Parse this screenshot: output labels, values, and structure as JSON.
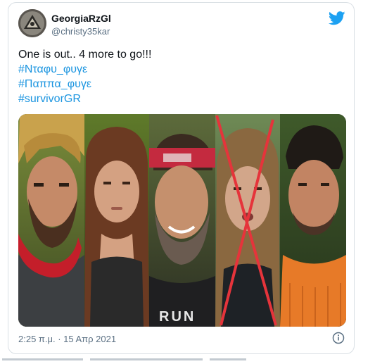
{
  "author": {
    "display_name": "GeorgiaRzGl",
    "handle": "@christy35kar"
  },
  "tweet": {
    "text": "One is out.. 4 more to go!!!",
    "hashtags": [
      "#Νταφυ_φυγε",
      "#Παππα_φυγε",
      "#survivorGR"
    ]
  },
  "meta": {
    "timestamp": "2:25 π.μ. · 15 Απρ 2021"
  },
  "colors": {
    "brand": "#1da1f2",
    "hashtag": "#1b95e0",
    "secondary_text": "#5b7083",
    "cross_mark": "#e5343b"
  },
  "icons": {
    "brand_icon": "twitter-bird-icon",
    "info_icon": "info-circle-icon"
  }
}
